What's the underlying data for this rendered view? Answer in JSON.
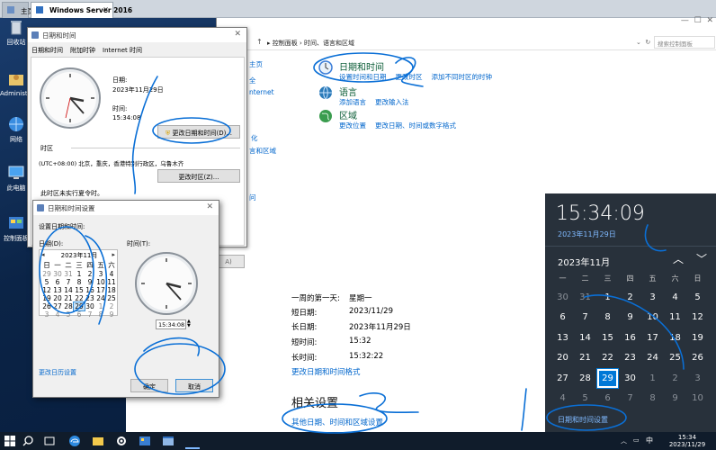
{
  "browser_tabs": [
    {
      "label": "主页"
    },
    {
      "label": "Windows Server 2016"
    }
  ],
  "desktop_icons": [
    {
      "label": "回收站"
    },
    {
      "label": "Administr..."
    },
    {
      "label": "网络"
    },
    {
      "label": "此电脑"
    },
    {
      "label": "控制面板"
    }
  ],
  "control_panel": {
    "breadcrumb": [
      "控制面板",
      "时间、语言和区域"
    ],
    "search_placeholder": "搜索控制面板",
    "side_links": [
      "主页",
      "全",
      "nternet",
      "化",
      "性化",
      "言和区域",
      "问"
    ],
    "categories": [
      {
        "title": "日期和时间",
        "links": [
          "设置时间和日期",
          "更改时区",
          "添加不同时区的时钟"
        ],
        "color": "#3b7dd8"
      },
      {
        "title": "语言",
        "links": [
          "添加语言",
          "更改输入法"
        ],
        "color": "#2a7ab8"
      },
      {
        "title": "区域",
        "links": [
          "更改位置",
          "更改日期、时间或数字格式"
        ],
        "color": "#3a9c4e"
      }
    ]
  },
  "settings_panel": {
    "rows": [
      {
        "label": "一周的第一天:",
        "value": "星期一"
      },
      {
        "label": "短日期:",
        "value": "2023/11/29"
      },
      {
        "label": "长日期:",
        "value": "2023年11月29日"
      },
      {
        "label": "短时间:",
        "value": "15:32"
      },
      {
        "label": "长时间:",
        "value": "15:32:22"
      }
    ],
    "change_format_link": "更改日期和时间格式",
    "related_heading": "相关设置",
    "related_link": "其他日期、时间和区域设置"
  },
  "datetime_dialog": {
    "title": "日期和时间",
    "tabs": [
      "日期和时间",
      "附加时钟",
      "Internet 时间"
    ],
    "date_label": "日期:",
    "date_value": "2023年11月29日",
    "time_label": "时间:",
    "time_value": "15:34:08",
    "change_datetime_btn": "更改日期和时间(D)...",
    "timezone_heading": "时区",
    "timezone_value": "(UTC+08:00) 北京，重庆，香港特别行政区，乌鲁木齐",
    "change_tz_btn": "更改时区(Z)...",
    "dst_note": "此时区未实行夏令时。",
    "bottom_btn_partial": "A)"
  },
  "datetime_settings": {
    "title": "日期和时间设置",
    "instruction": "设置日期和时间:",
    "date_label": "日期(D):",
    "time_label": "时间(T):",
    "month_header": "2023年11月",
    "weekdays": [
      "日",
      "一",
      "二",
      "三",
      "四",
      "五",
      "六"
    ],
    "weeks": [
      [
        "29",
        "30",
        "31",
        "1",
        "2",
        "3",
        "4"
      ],
      [
        "5",
        "6",
        "7",
        "8",
        "9",
        "10",
        "11"
      ],
      [
        "12",
        "13",
        "14",
        "15",
        "16",
        "17",
        "18"
      ],
      [
        "19",
        "20",
        "21",
        "22",
        "23",
        "24",
        "25"
      ],
      [
        "26",
        "27",
        "28",
        "29",
        "30",
        "1",
        "2"
      ],
      [
        "3",
        "4",
        "5",
        "6",
        "7",
        "8",
        "9"
      ]
    ],
    "time_value": "15:34:08",
    "calendar_settings_link": "更改日历设置",
    "ok_btn": "确定",
    "cancel_btn": "取消"
  },
  "clock_flyout": {
    "time": "15:34:09",
    "date": "2023年11月29日",
    "month_header": "2023年11月",
    "weekdays": [
      "一",
      "二",
      "三",
      "四",
      "五",
      "六",
      "日"
    ],
    "weeks": [
      [
        "30",
        "31",
        "1",
        "2",
        "3",
        "4",
        "5"
      ],
      [
        "6",
        "7",
        "8",
        "9",
        "10",
        "11",
        "12"
      ],
      [
        "13",
        "14",
        "15",
        "16",
        "17",
        "18",
        "19"
      ],
      [
        "20",
        "21",
        "22",
        "23",
        "24",
        "25",
        "26"
      ],
      [
        "27",
        "28",
        "29",
        "30",
        "1",
        "2",
        "3"
      ],
      [
        "4",
        "5",
        "6",
        "7",
        "8",
        "9",
        "10"
      ]
    ],
    "settings_link": "日期和时间设置"
  },
  "taskbar": {
    "clock_time": "15:34",
    "clock_date": "2023/11/29",
    "ime": "中"
  },
  "colors": {
    "accent": "#0078d7",
    "link": "#0066cc",
    "flyout_bg": "#1f2933",
    "ink": "#0a6fd6"
  }
}
